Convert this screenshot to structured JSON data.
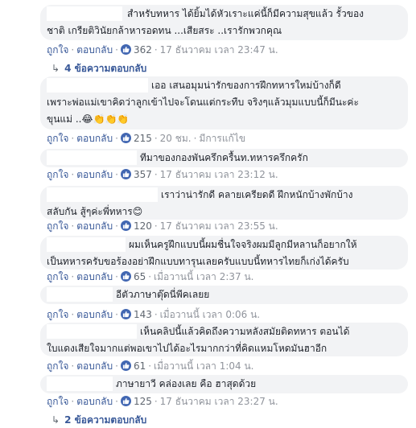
{
  "comments": [
    {
      "lines": [
        "สำหรับทหาร ได้ยิ้มได้หัวเราะแค่นี้ก็มีความสุขแล้ว รั้วของ",
        "ชาติ เกรียติวินัยกล้าหารอดทน ...เสียสระ ..เรารักพวกคุณ"
      ],
      "like": "ถูกใจ",
      "reply": "ตอบกลับ",
      "count": "362",
      "time": "17 ธันวาคม เวลา 23:47 น.",
      "replies": "4 ข้อความตอบกลับ"
    },
    {
      "lines": [
        "เออ เสนอมุมน่ารักของการฝึกทหารใหม่บ้างก็ดี",
        "เพราะพ่อแม่เขาคิดว่าลูกเข้าไปจะโดนแต่กระทืบ จริงๆแล้วมุมแบบนี้ก็มีนะค่ะ",
        "ขุนแม่ ..😂👏👏👏"
      ],
      "like": "ถูกใจ",
      "reply": "ตอบกลับ",
      "count": "215",
      "time": "20 ชม.",
      "edited": "มีการแก้ไข"
    },
    {
      "lines": [
        "ทีมาของกองพันครึกครื้นท.ทหารครึกครัก"
      ],
      "like": "ถูกใจ",
      "reply": "ตอบกลับ",
      "count": "357",
      "time": "17 ธันวาคม เวลา 23:12 น."
    },
    {
      "lines": [
        "เราว่าน่ารักดี คลายเครียดดี ฝึกหนักบ้างพักบ้าง",
        "สลับกัน สู้ๆค่ะพี่ทหาร😊"
      ],
      "like": "ถูกใจ",
      "reply": "ตอบกลับ",
      "count": "120",
      "time": "17 ธันวาคม เวลา 23:55 น."
    },
    {
      "lines": [
        "ผมเห็นครูฝึกแบบนี้ผมชื่นใจจริงผมมีลูกมีหลานก็อยากให้",
        "เป็นทหารครับขอร้องอย่าฝึกแบบทารุนเลยครับแบบนี้ทหารไทยก็เก่งได้ครับ"
      ],
      "like": "ถูกใจ",
      "reply": "ตอบกลับ",
      "count": "65",
      "time": "เมื่อวานนี้ เวลา 2:37 น."
    },
    {
      "lines": [
        "อีตัวภาษาตุ๊ดนี่พีคเลยย"
      ],
      "like": "ถูกใจ",
      "reply": "ตอบกลับ",
      "count": "143",
      "time": "เมื่อวานนี้ เวลา 0:06 น."
    },
    {
      "lines": [
        "เห็นคลิปนี้แล้วคิดถึงความหลังสมัยติดทหาร ตอนได้",
        "ใบแดงเสียใจมากแต่พอเขาไปได้อะไรมากกว่าที่คิดแหมโหดมันฮาอีก"
      ],
      "like": "ถูกใจ",
      "reply": "ตอบกลับ",
      "count": "61",
      "time": "เมื่อวานนี้ เวลา 1:04 น."
    },
    {
      "lines": [
        "ภาษายาวี คล่องเลย คือ ฮาสุดด้วย"
      ],
      "like": "ถูกใจ",
      "reply": "ตอบกลับ",
      "count": "125",
      "time": "17 ธันวาคม เวลา 23:27 น.",
      "replies": "2 ข้อความตอบกลับ"
    }
  ],
  "colors": {
    "bubble": "#f2f3f5",
    "link": "#385898",
    "meta": "#90949c",
    "like_badge": "#4267b2"
  }
}
